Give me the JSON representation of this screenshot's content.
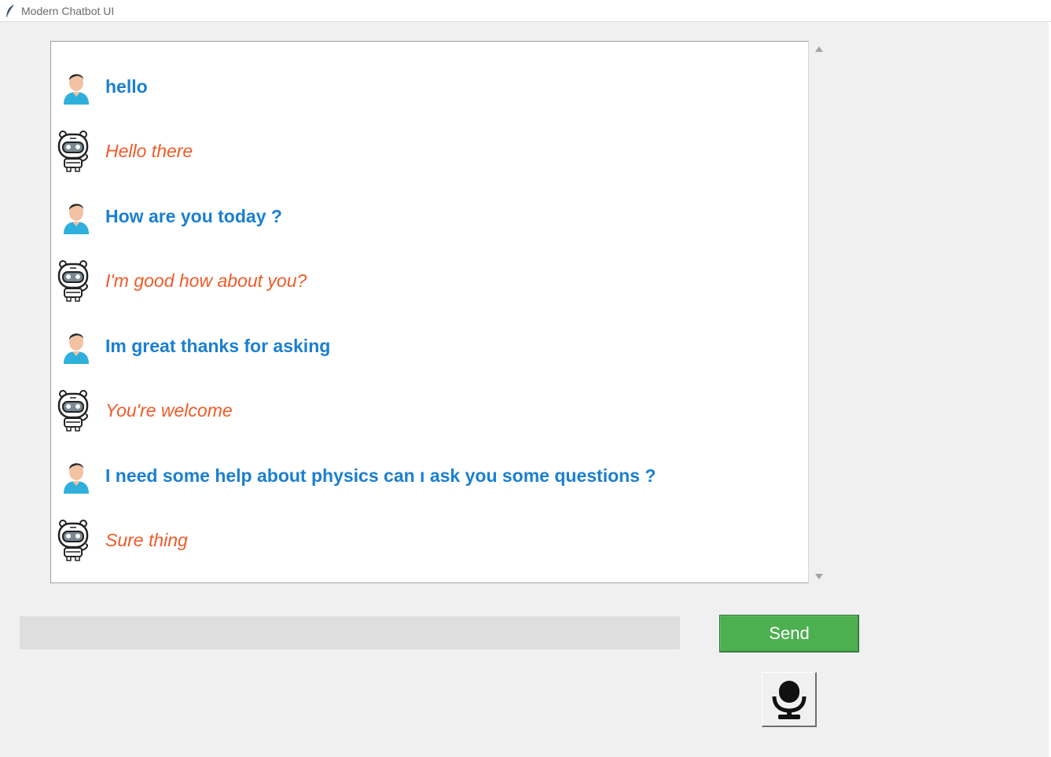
{
  "window": {
    "title": "Modern Chatbot UI",
    "icon": "feather-icon"
  },
  "colors": {
    "user_text": "#1a7fd0",
    "bot_text": "#f05a28",
    "send_button": "#4caf50"
  },
  "messages": [
    {
      "sender": "user",
      "text": "hello"
    },
    {
      "sender": "bot",
      "text": "Hello there"
    },
    {
      "sender": "user",
      "text": "How are you today ?"
    },
    {
      "sender": "bot",
      "text": "I'm good how about you?"
    },
    {
      "sender": "user",
      "text": "Im great thanks for asking"
    },
    {
      "sender": "bot",
      "text": "You're welcome"
    },
    {
      "sender": "user",
      "text": "I need some help about physics can ı ask you some questions ?"
    },
    {
      "sender": "bot",
      "text": "Sure thing"
    }
  ],
  "input": {
    "value": ""
  },
  "send_button": {
    "label": "Send"
  },
  "mic_button": {
    "icon": "microphone-icon"
  }
}
